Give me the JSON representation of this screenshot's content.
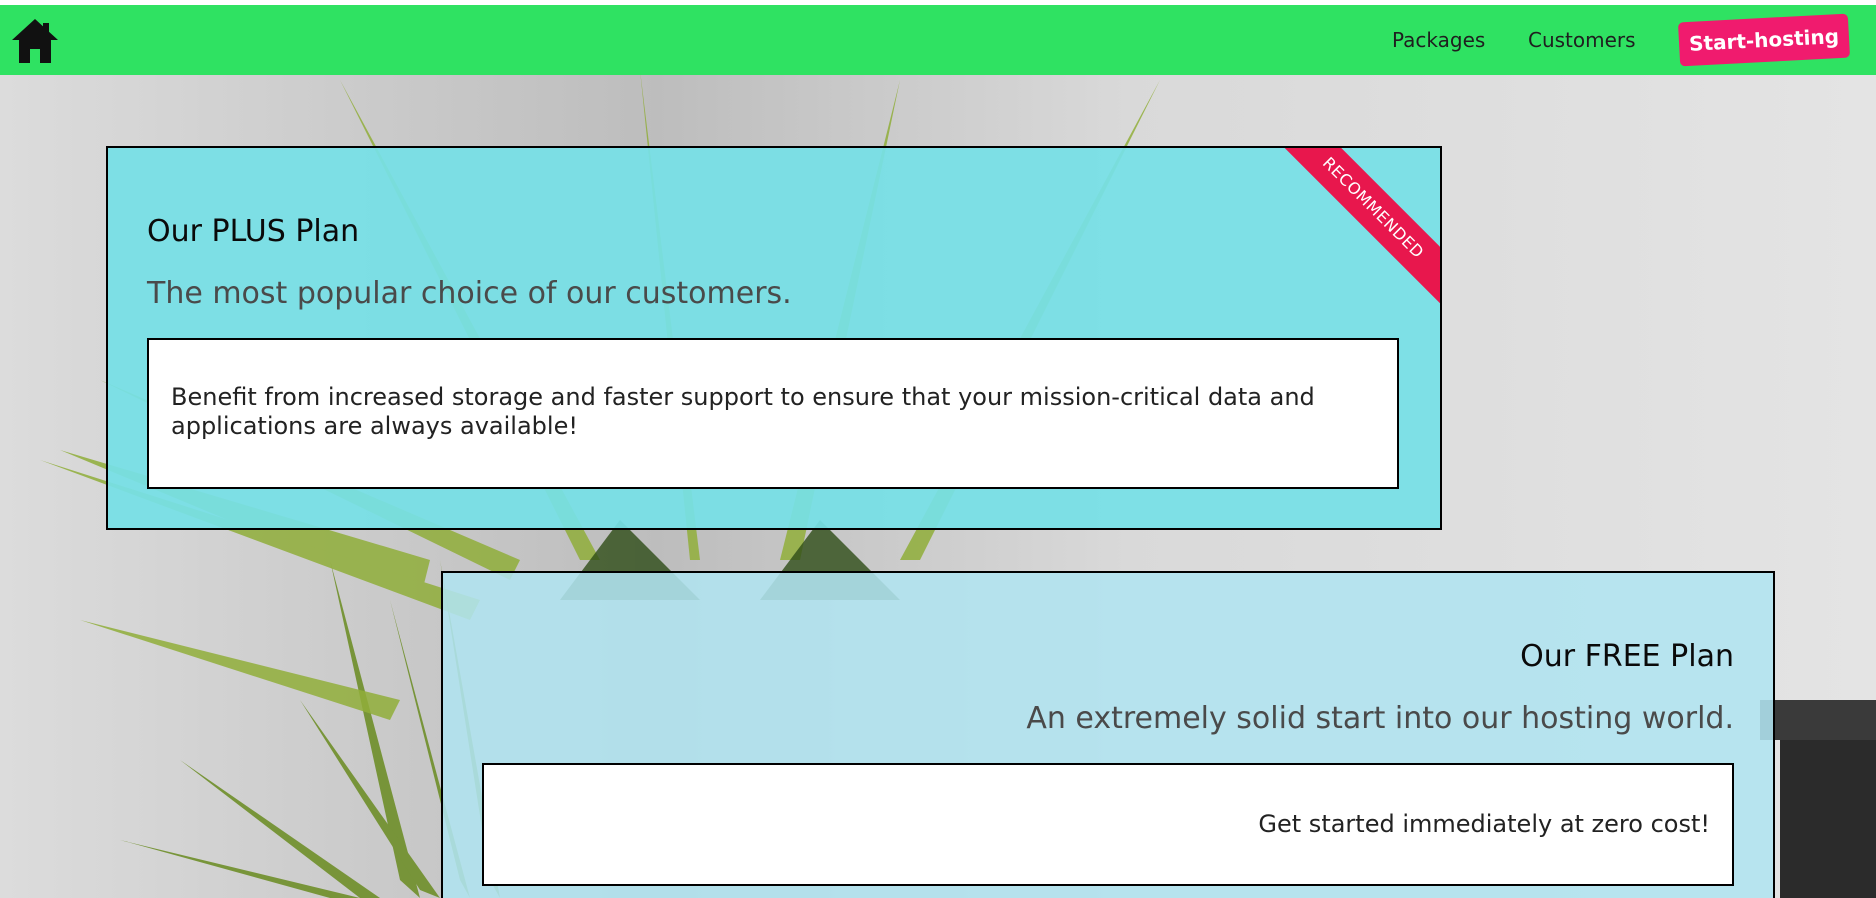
{
  "header": {
    "home_icon": "home-icon",
    "nav": [
      {
        "label": "Packages"
      },
      {
        "label": "Customers"
      }
    ],
    "cta_label": "Start-hosting",
    "colors": {
      "bar": "#2fe262",
      "cta": "#f01b6e"
    }
  },
  "plans": [
    {
      "title": "Our PLUS Plan",
      "subtitle": "The most popular choice of our customers.",
      "description": "Benefit from increased storage and faster support to ensure that your mission-critical data and applications are always available!",
      "ribbon": "RECOMMENDED"
    },
    {
      "title": "Our FREE Plan",
      "subtitle": "An extremely solid start into our hosting world.",
      "description": "Get started immediately at zero cost!"
    }
  ]
}
